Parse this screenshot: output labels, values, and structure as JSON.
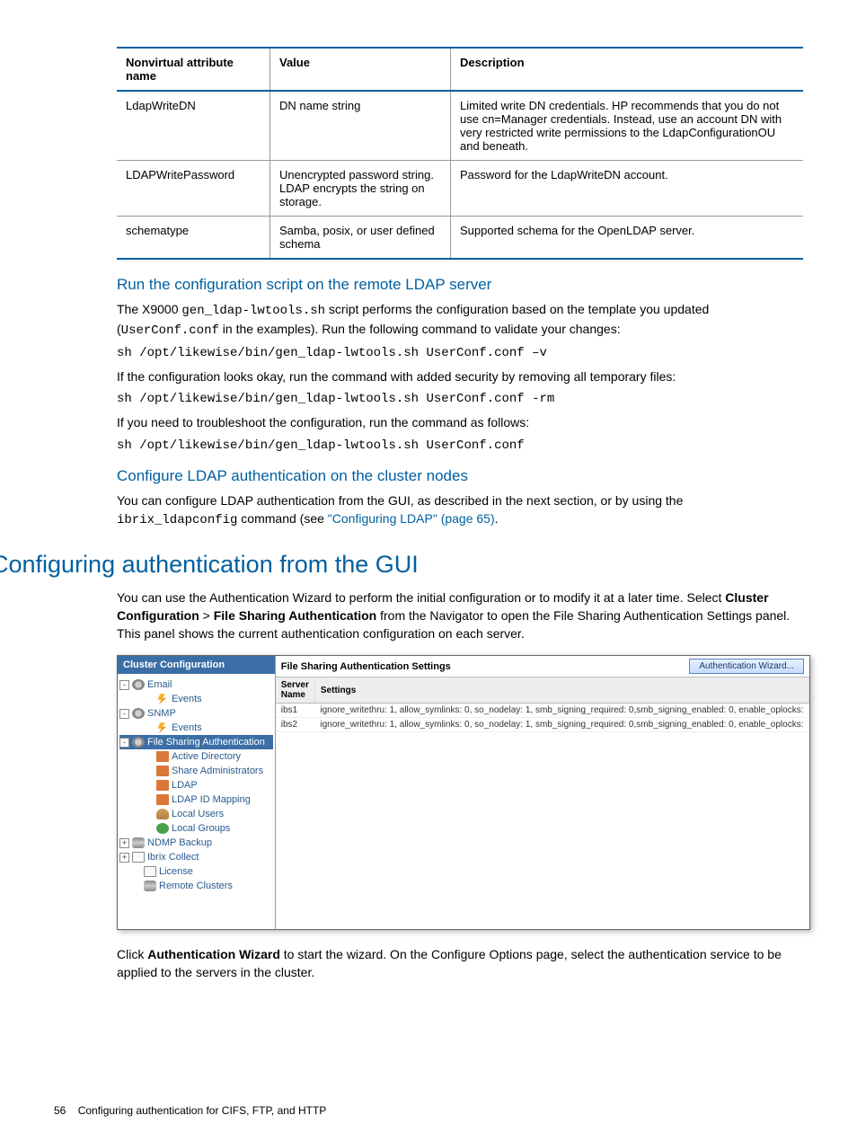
{
  "table": {
    "headers": [
      "Nonvirtual attribute name",
      "Value",
      "Description"
    ],
    "rows": [
      {
        "name": "LdapWriteDN",
        "value": "DN name string",
        "desc": "Limited write DN credentials. HP recommends that you do not use cn=Manager credentials. Instead, use an account DN with very restricted write permissions to the LdapConfigurationOU and beneath."
      },
      {
        "name": "LDAPWritePassword",
        "value": "Unencrypted password string. LDAP encrypts the string on storage.",
        "desc": "Password for the LdapWriteDN account."
      },
      {
        "name": "schematype",
        "value": "Samba, posix, or user defined schema",
        "desc": "Supported schema for the OpenLDAP server."
      }
    ]
  },
  "sec1": {
    "title": "Run the configuration script on the remote LDAP server",
    "p1a": "The X9000 ",
    "p1b": "gen_ldap-lwtools.sh",
    "p1c": " script performs the configuration based on the template you updated (",
    "p1d": "UserConf.conf",
    "p1e": " in the examples). Run the following command to validate your changes:",
    "cmd1": "sh /opt/likewise/bin/gen_ldap-lwtools.sh UserConf.conf –v",
    "p2": "If the configuration looks okay, run the command with added security by removing all temporary files:",
    "cmd2": "sh /opt/likewise/bin/gen_ldap-lwtools.sh UserConf.conf -rm",
    "p3": "If you need to troubleshoot the configuration, run the command as follows:",
    "cmd3": "sh /opt/likewise/bin/gen_ldap-lwtools.sh UserConf.conf"
  },
  "sec2": {
    "title": "Configure LDAP authentication on the cluster nodes",
    "p1a": "You can configure LDAP authentication from the GUI, as described in the next section, or by using the ",
    "p1b": "ibrix_ldapconfig",
    "p1c": " command (see ",
    "link": "\"Configuring LDAP\" (page 65)",
    "p1d": "."
  },
  "h2": "Configuring authentication from the GUI",
  "gui": {
    "p1a": "You can use the Authentication Wizard to perform the initial configuration or to modify it at a later time. Select ",
    "p1b": "Cluster Configuration",
    "p1c": " > ",
    "p1d": "File Sharing Authentication",
    "p1e": " from the Navigator to open the File Sharing Authentication Settings panel. This panel shows the current authentication configuration on each server.",
    "p2a": "Click ",
    "p2b": "Authentication Wizard",
    "p2c": " to start the wizard. On the Configure Options page, select the authentication service to be applied to the servers in the cluster."
  },
  "shot": {
    "navTitle": "Cluster Configuration",
    "tree": [
      {
        "indent": 0,
        "exp": "-",
        "icon": "gear",
        "label": "Email"
      },
      {
        "indent": 28,
        "icon": "bolt",
        "label": "Events"
      },
      {
        "indent": 0,
        "exp": "-",
        "icon": "gear",
        "label": "SNMP"
      },
      {
        "indent": 28,
        "icon": "bolt",
        "label": "Events"
      },
      {
        "indent": 0,
        "exp": "-",
        "icon": "gear",
        "label": "File Sharing Authentication",
        "selected": true
      },
      {
        "indent": 28,
        "icon": "ldap",
        "label": "Active Directory"
      },
      {
        "indent": 28,
        "icon": "ldap",
        "label": "Share Administrators"
      },
      {
        "indent": 28,
        "icon": "ldap",
        "label": "LDAP"
      },
      {
        "indent": 28,
        "icon": "ldap",
        "label": "LDAP ID Mapping"
      },
      {
        "indent": 28,
        "icon": "user",
        "label": "Local Users"
      },
      {
        "indent": 28,
        "icon": "group",
        "label": "Local Groups"
      },
      {
        "indent": 0,
        "exp": "+",
        "icon": "db",
        "label": "NDMP Backup"
      },
      {
        "indent": 0,
        "exp": "+",
        "icon": "doc",
        "label": "Ibrix Collect"
      },
      {
        "indent": 14,
        "icon": "doc",
        "label": "License"
      },
      {
        "indent": 14,
        "icon": "db",
        "label": "Remote Clusters"
      }
    ],
    "panelTitle": "File Sharing Authentication Settings",
    "wizard": "Authentication Wizard...",
    "cols": [
      "Server Name",
      "Settings"
    ],
    "rows": [
      {
        "server": "ibs1",
        "settings": "ignore_writethru: 1, allow_symlinks: 0, so_nodelay: 1, smb_signing_required: 0,smb_signing_enabled: 0, enable_oplocks:"
      },
      {
        "server": "ibs2",
        "settings": "ignore_writethru: 1, allow_symlinks: 0, so_nodelay: 1, smb_signing_required: 0,smb_signing_enabled: 0, enable_oplocks:"
      }
    ]
  },
  "footer": {
    "pageNum": "56",
    "chapter": "Configuring authentication for CIFS, FTP, and HTTP"
  }
}
